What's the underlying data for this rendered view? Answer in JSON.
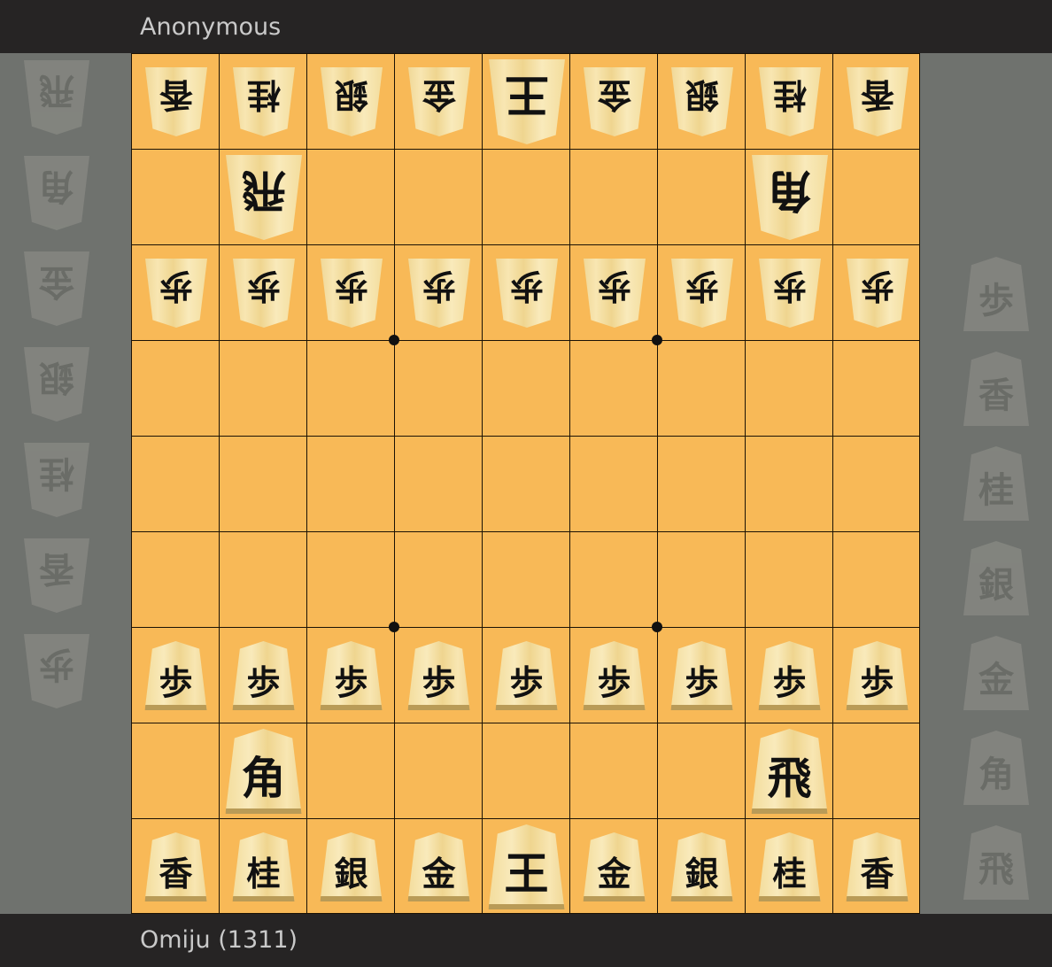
{
  "players": {
    "top": {
      "name": "Anonymous"
    },
    "bottom": {
      "name": "Omiju (1311)"
    }
  },
  "board": {
    "files": 9,
    "ranks": 9,
    "star_points": [
      [
        3,
        3
      ],
      [
        6,
        3
      ],
      [
        3,
        6
      ],
      [
        6,
        6
      ]
    ],
    "rows": [
      [
        {
          "p": "香",
          "s": "gote"
        },
        {
          "p": "桂",
          "s": "gote"
        },
        {
          "p": "銀",
          "s": "gote"
        },
        {
          "p": "金",
          "s": "gote"
        },
        {
          "p": "王",
          "s": "gote",
          "big": true
        },
        {
          "p": "金",
          "s": "gote"
        },
        {
          "p": "銀",
          "s": "gote"
        },
        {
          "p": "桂",
          "s": "gote"
        },
        {
          "p": "香",
          "s": "gote"
        }
      ],
      [
        null,
        {
          "p": "飛",
          "s": "gote",
          "big": true
        },
        null,
        null,
        null,
        null,
        null,
        {
          "p": "角",
          "s": "gote",
          "big": true
        },
        null
      ],
      [
        {
          "p": "歩",
          "s": "gote"
        },
        {
          "p": "歩",
          "s": "gote"
        },
        {
          "p": "歩",
          "s": "gote"
        },
        {
          "p": "歩",
          "s": "gote"
        },
        {
          "p": "歩",
          "s": "gote"
        },
        {
          "p": "歩",
          "s": "gote"
        },
        {
          "p": "歩",
          "s": "gote"
        },
        {
          "p": "歩",
          "s": "gote"
        },
        {
          "p": "歩",
          "s": "gote"
        }
      ],
      [
        null,
        null,
        null,
        null,
        null,
        null,
        null,
        null,
        null
      ],
      [
        null,
        null,
        null,
        null,
        null,
        null,
        null,
        null,
        null
      ],
      [
        null,
        null,
        null,
        null,
        null,
        null,
        null,
        null,
        null
      ],
      [
        {
          "p": "歩",
          "s": "sente"
        },
        {
          "p": "歩",
          "s": "sente"
        },
        {
          "p": "歩",
          "s": "sente"
        },
        {
          "p": "歩",
          "s": "sente"
        },
        {
          "p": "歩",
          "s": "sente"
        },
        {
          "p": "歩",
          "s": "sente"
        },
        {
          "p": "歩",
          "s": "sente"
        },
        {
          "p": "歩",
          "s": "sente"
        },
        {
          "p": "歩",
          "s": "sente"
        }
      ],
      [
        null,
        {
          "p": "角",
          "s": "sente",
          "big": true
        },
        null,
        null,
        null,
        null,
        null,
        {
          "p": "飛",
          "s": "sente",
          "big": true
        },
        null
      ],
      [
        {
          "p": "香",
          "s": "sente"
        },
        {
          "p": "桂",
          "s": "sente"
        },
        {
          "p": "銀",
          "s": "sente"
        },
        {
          "p": "金",
          "s": "sente"
        },
        {
          "p": "王",
          "s": "sente",
          "big": true
        },
        {
          "p": "金",
          "s": "sente"
        },
        {
          "p": "銀",
          "s": "sente"
        },
        {
          "p": "桂",
          "s": "sente"
        },
        {
          "p": "香",
          "s": "sente"
        }
      ]
    ]
  },
  "hands": {
    "gote": [
      "飛",
      "角",
      "金",
      "銀",
      "桂",
      "香",
      "歩"
    ],
    "sente": [
      "歩",
      "香",
      "桂",
      "銀",
      "金",
      "角",
      "飛"
    ]
  },
  "colors": {
    "board": "#f8b957",
    "bars": "#262424",
    "background": "#6f726e"
  }
}
